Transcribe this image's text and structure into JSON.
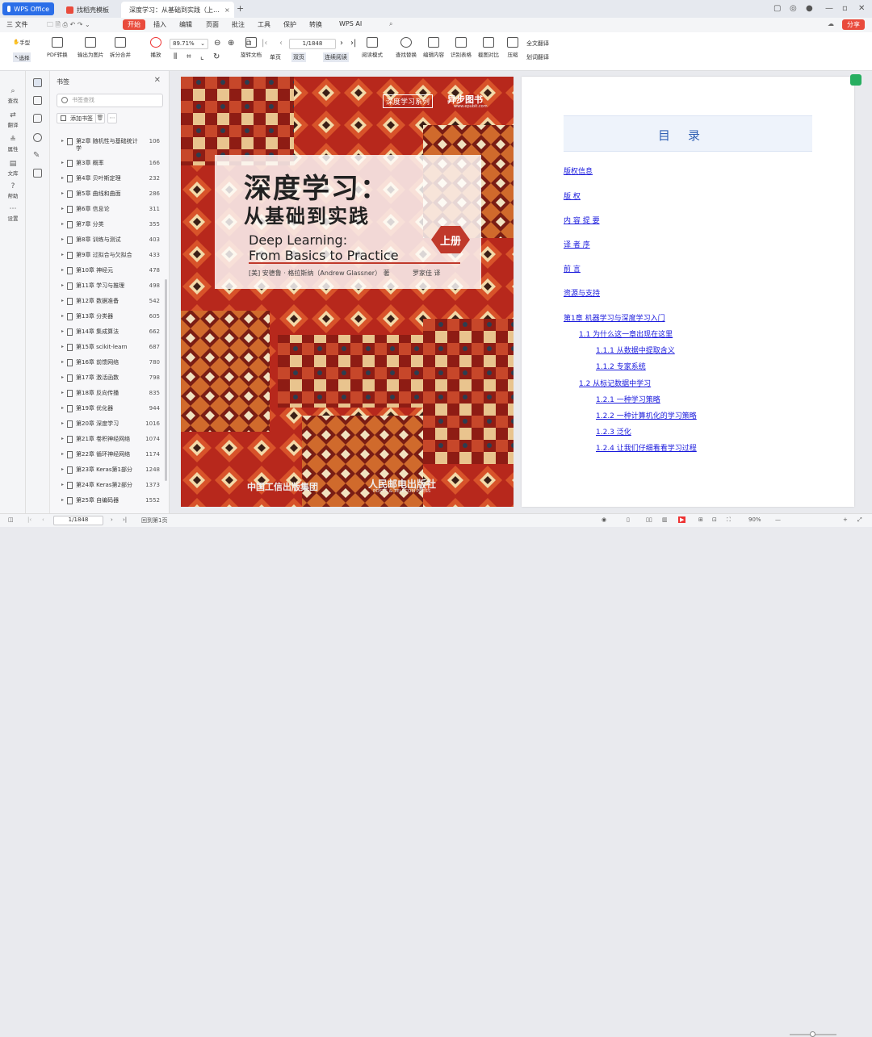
{
  "tabs": {
    "wps": "WPS Office",
    "template": "找稻壳模板",
    "doc": "深度学习：从基础到实践（上…",
    "add": "+"
  },
  "menu": [
    "三 文件",
    "开始",
    "插入",
    "编辑",
    "页面",
    "批注",
    "工具",
    "保护",
    "转换",
    "WPS AI"
  ],
  "menu_active": "开始",
  "share_label": "分享",
  "ribbon": {
    "hand": "手型",
    "select": "选择",
    "pdf_convert": "PDF转换",
    "to_image": "输出为图片",
    "split_merge": "拆分合并",
    "play": "播放",
    "zoom": "89.71%",
    "page_input": "1/1848",
    "rotate": "旋转文档",
    "single": "单页",
    "double": "双页",
    "continuous": "连续阅读",
    "read_mode": "阅读模式",
    "find_replace": "查找替换",
    "edit_content": "编辑内容",
    "recognize_table": "识别表格",
    "screenshot_compare": "截图对比",
    "compress": "压缩",
    "full_translate": "全文翻译",
    "word_translate": "划词翻译"
  },
  "rail": [
    "查找",
    "翻译",
    "属性",
    "文库",
    "帮助",
    "设置"
  ],
  "bookmarks": {
    "title": "书签",
    "search_placeholder": "书签查找",
    "add_label": "添加书签",
    "items": [
      {
        "label": "第2章 随机性与基础统计学",
        "page": "106"
      },
      {
        "label": "第3章 概率",
        "page": "166"
      },
      {
        "label": "第4章 贝叶斯定理",
        "page": "232"
      },
      {
        "label": "第5章 曲线和曲面",
        "page": "286"
      },
      {
        "label": "第6章 信息论",
        "page": "311"
      },
      {
        "label": "第7章 分类",
        "page": "355"
      },
      {
        "label": "第8章 训练与测试",
        "page": "403"
      },
      {
        "label": "第9章 过拟合与欠拟合",
        "page": "433"
      },
      {
        "label": "第10章 神经元",
        "page": "478"
      },
      {
        "label": "第11章 学习与推理",
        "page": "498"
      },
      {
        "label": "第12章 数据准备",
        "page": "542"
      },
      {
        "label": "第13章 分类器",
        "page": "605"
      },
      {
        "label": "第14章 集成算法",
        "page": "662"
      },
      {
        "label": "第15章 scikit-learn",
        "page": "687"
      },
      {
        "label": "第16章 前馈网络",
        "page": "780"
      },
      {
        "label": "第17章 激活函数",
        "page": "798"
      },
      {
        "label": "第18章 反向传播",
        "page": "835"
      },
      {
        "label": "第19章 优化器",
        "page": "944"
      },
      {
        "label": "第20章 深度学习",
        "page": "1016"
      },
      {
        "label": "第21章 卷积神经网络",
        "page": "1074"
      },
      {
        "label": "第22章 循环神经网络",
        "page": "1174"
      },
      {
        "label": "第23章 Keras第1部分",
        "page": "1248"
      },
      {
        "label": "第24章 Keras第2部分",
        "page": "1373"
      },
      {
        "label": "第25章 自编码器",
        "page": "1552"
      }
    ]
  },
  "cover": {
    "series": "深度学习系列",
    "publisher_brand": "异步图书",
    "publisher_url": "www.epubit.com",
    "title_cn_1": "深度学习：",
    "title_cn_2": "从基础到实践",
    "title_en_1": "Deep Learning:",
    "title_en_2": "From Basics to Practice",
    "volume": "上册",
    "author": "[美] 安德鲁 · 格拉斯纳（Andrew Glassner） 著",
    "translator": "罗家佳 译",
    "publisher1": "中国工信出版集团",
    "publisher2": "人民邮电出版社",
    "publisher2_en": "POSTS & TELECOM PRESS"
  },
  "toc": {
    "heading": "目录",
    "entries": [
      {
        "text": "版权信息",
        "level": 0
      },
      {
        "text": "版 权",
        "level": 0
      },
      {
        "text": "内 容 提 要",
        "level": 0
      },
      {
        "text": "译 者 序",
        "level": 0
      },
      {
        "text": "前 言",
        "level": 0
      },
      {
        "text": "资源与支持",
        "level": 0
      },
      {
        "text": "第1章 机器学习与深度学习入门",
        "level": 0
      },
      {
        "text": "1.1 为什么这一章出现在这里",
        "level": 1
      },
      {
        "text": "1.1.1 从数据中提取含义",
        "level": 2
      },
      {
        "text": "1.1.2 专家系统",
        "level": 2
      },
      {
        "text": "1.2 从标记数据中学习",
        "level": 1
      },
      {
        "text": "1.2.1 一种学习策略",
        "level": 2
      },
      {
        "text": "1.2.2 一种计算机化的学习策略",
        "level": 2
      },
      {
        "text": "1.2.3 泛化",
        "level": 2
      },
      {
        "text": "1.2.4 让我们仔细看看学习过程",
        "level": 2
      }
    ]
  },
  "status": {
    "page": "1/1848",
    "return": "回到第1页",
    "zoom": "90%"
  },
  "colors": {
    "accent": "#2b6ee8",
    "brand_red": "#e94b3c",
    "link": "#1a1adc"
  }
}
